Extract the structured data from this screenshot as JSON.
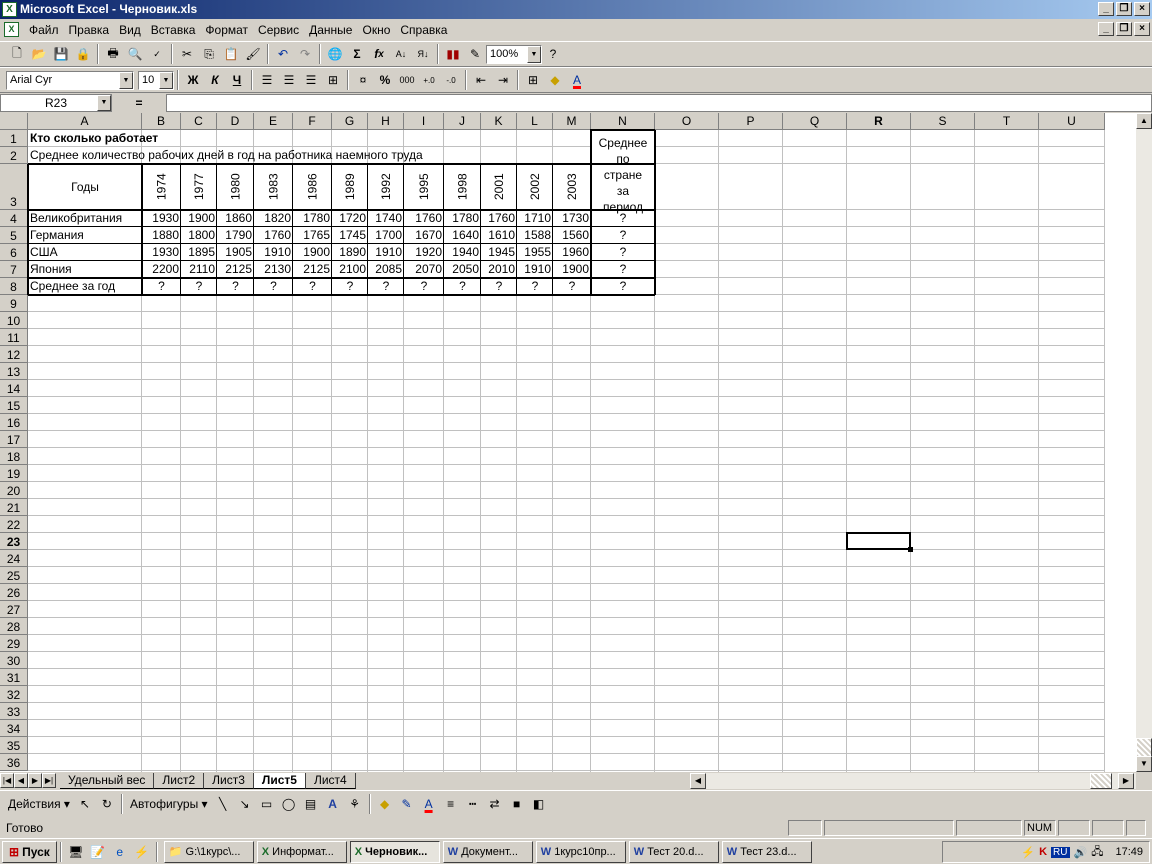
{
  "window": {
    "title": "Microsoft Excel - Черновик.xls"
  },
  "menu": [
    "Файл",
    "Правка",
    "Вид",
    "Вставка",
    "Формат",
    "Сервис",
    "Данные",
    "Окно",
    "Справка"
  ],
  "toolbar": {
    "zoom": "100%",
    "font_name": "Arial Cyr",
    "font_size": "10"
  },
  "formula": {
    "cell_ref": "R23",
    "equals": "=",
    "value": ""
  },
  "columns": [
    "A",
    "B",
    "C",
    "D",
    "E",
    "F",
    "G",
    "H",
    "I",
    "J",
    "K",
    "L",
    "M",
    "N",
    "O",
    "P",
    "Q",
    "R",
    "S",
    "T",
    "U"
  ],
  "sheet": {
    "title": "Кто сколько работает",
    "subtitle": "Среднее количество рабочих дней в год на работника наемного труда",
    "years_label": "Годы",
    "avg_header": "Среднее по стране за период",
    "years": [
      "1974",
      "1977",
      "1980",
      "1983",
      "1986",
      "1989",
      "1992",
      "1995",
      "1998",
      "2001",
      "2002",
      "2003"
    ],
    "rows": [
      {
        "country": "Великобритания",
        "values": [
          "1930",
          "1900",
          "1860",
          "1820",
          "1780",
          "1720",
          "1740",
          "1760",
          "1780",
          "1760",
          "1710",
          "1730"
        ],
        "avg": "?"
      },
      {
        "country": "Германия",
        "values": [
          "1880",
          "1800",
          "1790",
          "1760",
          "1765",
          "1745",
          "1700",
          "1670",
          "1640",
          "1610",
          "1588",
          "1560"
        ],
        "avg": "?"
      },
      {
        "country": "США",
        "values": [
          "1930",
          "1895",
          "1905",
          "1910",
          "1900",
          "1890",
          "1910",
          "1920",
          "1940",
          "1945",
          "1955",
          "1960"
        ],
        "avg": "?"
      },
      {
        "country": "Япония",
        "values": [
          "2200",
          "2110",
          "2125",
          "2130",
          "2125",
          "2100",
          "2085",
          "2070",
          "2050",
          "2010",
          "1910",
          "1900"
        ],
        "avg": "?"
      }
    ],
    "avg_row": {
      "label": "Среднее за год",
      "values": [
        "?",
        "?",
        "?",
        "?",
        "?",
        "?",
        "?",
        "?",
        "?",
        "?",
        "?",
        "?"
      ],
      "avg": "?"
    }
  },
  "sheet_tabs": [
    "Удельный вес",
    "Лист2",
    "Лист3",
    "Лист5",
    "Лист4"
  ],
  "active_tab": "Лист5",
  "drawing": {
    "actions": "Действия",
    "autoshapes": "Автофигуры"
  },
  "status": {
    "text": "Готово",
    "num": "NUM"
  },
  "taskbar": {
    "start": "Пуск",
    "buttons": [
      "G:\\1курс\\...",
      "Информат...",
      "Черновик...",
      "Документ...",
      "1курс10пр...",
      "Тест 20.d...",
      "Тест 23.d..."
    ],
    "clock": "17:49",
    "lang": "RU"
  }
}
